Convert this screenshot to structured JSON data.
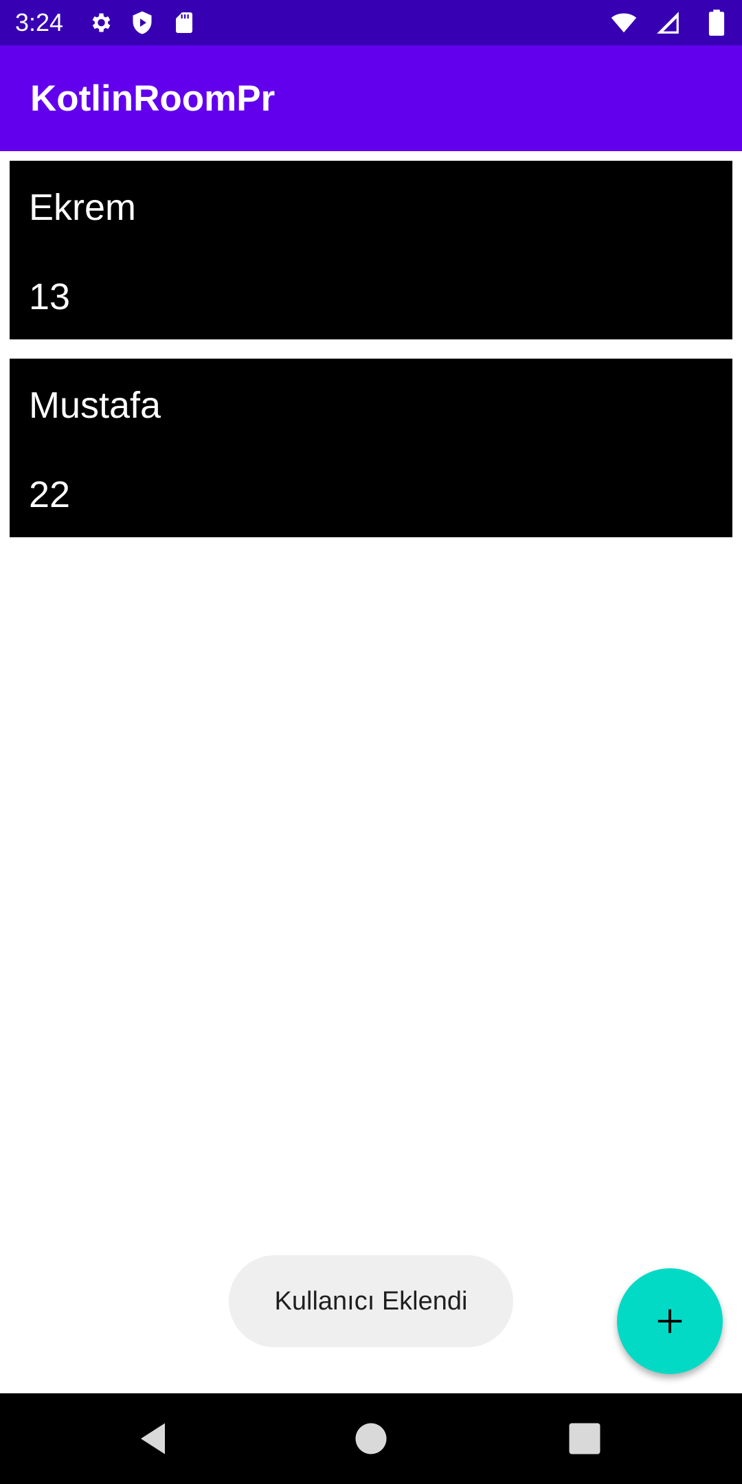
{
  "status_bar": {
    "time": "3:24",
    "left_icons": [
      "gear-icon",
      "shield-play-icon",
      "sd-card-icon"
    ],
    "right_icons": [
      "wifi-icon",
      "signal-icon",
      "battery-icon"
    ]
  },
  "app_bar": {
    "title": "KotlinRoomPr",
    "color": "#6200ee"
  },
  "users": [
    {
      "name": "Ekrem",
      "age": "13"
    },
    {
      "name": "Mustafa",
      "age": "22"
    }
  ],
  "toast": {
    "message": "Kullanıcı Eklendi"
  },
  "fab": {
    "icon": "plus-icon",
    "color": "#03dac5"
  },
  "nav_bar": {
    "icons": [
      "back-icon",
      "home-icon",
      "recents-icon"
    ]
  }
}
